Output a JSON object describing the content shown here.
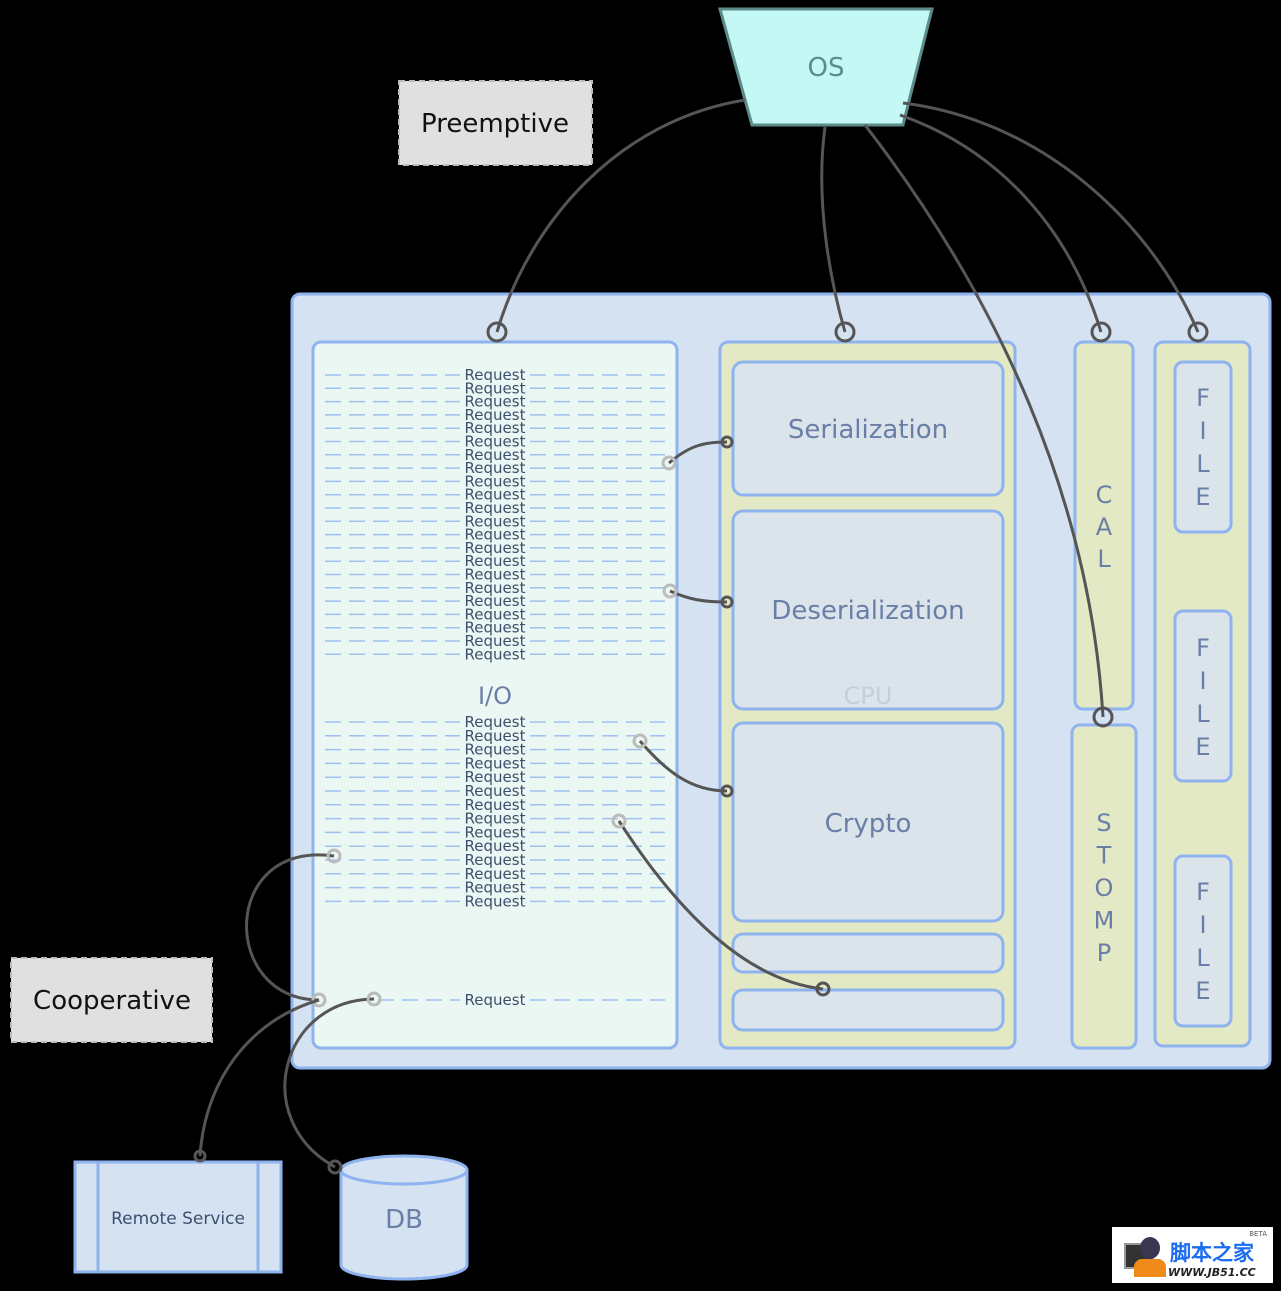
{
  "labels": {
    "os": "OS",
    "preemptive": "Preemptive",
    "cooperative": "Cooperative",
    "io": "I/O",
    "cpu": "CPU",
    "serialization": "Serialization",
    "deserialization": "Deserialization",
    "crypto": "Crypto",
    "cal": [
      "C",
      "A",
      "L"
    ],
    "stomp": [
      "S",
      "T",
      "O",
      "M",
      "P"
    ],
    "file": [
      "F",
      "I",
      "L",
      "E"
    ],
    "remote_service": "Remote Service",
    "db": "DB"
  },
  "io_requests": {
    "top_group": [
      "Request",
      "Request",
      "Request",
      "Request",
      "Request",
      "Request",
      "Request",
      "Request",
      "Request",
      "Request",
      "Request",
      "Request",
      "Request",
      "Request",
      "Request",
      "Request",
      "Request",
      "Request",
      "Request",
      "Request",
      "Request",
      "Request"
    ],
    "bottom_group": [
      "Request",
      "Request",
      "Request",
      "Request",
      "Request",
      "Request",
      "Request",
      "Request",
      "Request",
      "Request",
      "Request",
      "Request",
      "Request",
      "Request"
    ],
    "cooperative": "Request"
  },
  "watermark": {
    "text": "脚本之家",
    "url_text": "WWW.JB51.CC",
    "badge": "BETA"
  },
  "colors": {
    "os_fill": "#c4f8f4",
    "outer_fill": "#d5e2f2",
    "io_fill": "#eaf7f2",
    "cpu_fill": "#e2e9c4",
    "inner_fill": "#dbe4ea",
    "border": "#8fb3ef",
    "note_fill": "#e0e0e0"
  }
}
